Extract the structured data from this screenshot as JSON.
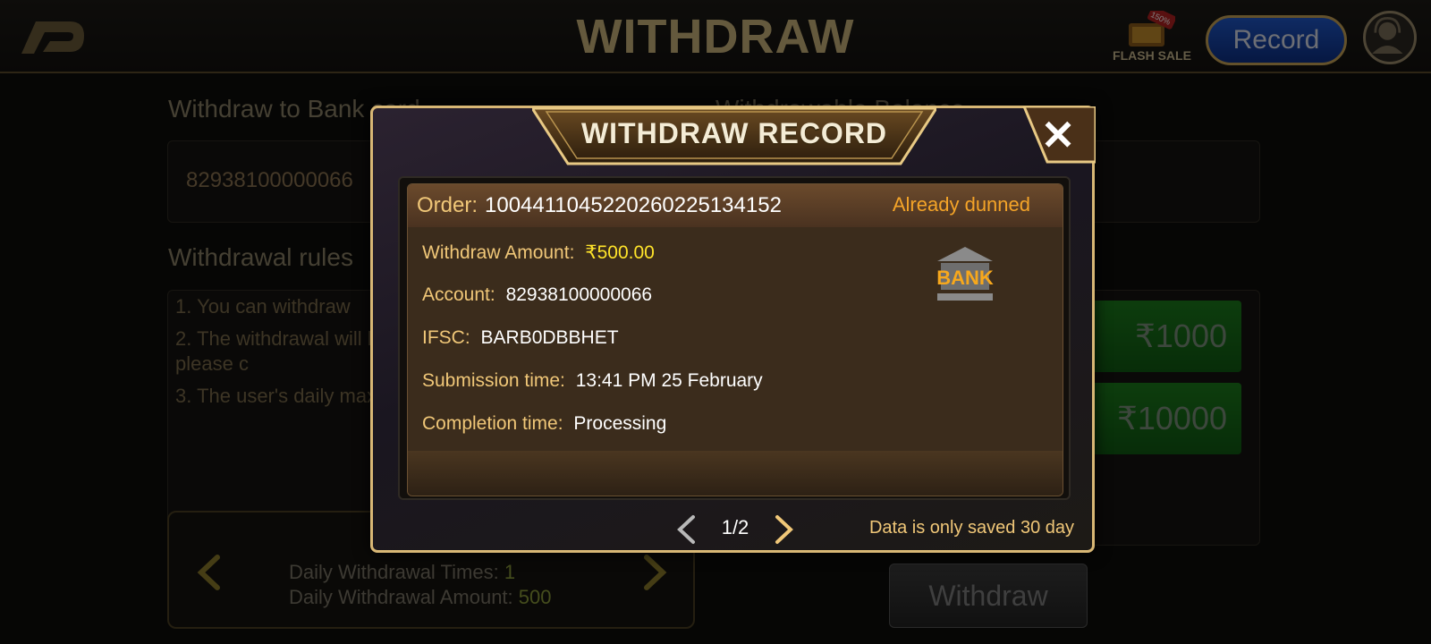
{
  "header": {
    "title": "WITHDRAW",
    "flash_sale_label": "FLASH SALE",
    "flash_sale_badge": "150%",
    "record_label": "Record"
  },
  "form": {
    "bank_label": "Withdraw to Bank card",
    "balance_label": "Withdrawable Balance",
    "bank_account": "82938100000066",
    "rules_title": "Withdrawal rules",
    "rules": [
      "1. You can withdraw",
      "2. The withdrawal will be credited within 24 hours at the latest, if not, please c",
      "3. The user's daily maximum withdrawal amount is 30,000."
    ],
    "amount_options": [
      "₹1000",
      "₹10000"
    ],
    "daily_times_label": "Daily Withdrawal Times:",
    "daily_times_value": "1",
    "daily_amount_label": "Daily Withdrawal Amount:",
    "daily_amount_value": "500",
    "withdraw_button": "Withdraw"
  },
  "modal": {
    "title": "WITHDRAW RECORD",
    "record": {
      "order_label": "Order:",
      "order_number": "100441104522026022513415 2",
      "status": "Already dunned",
      "amount_label": "Withdraw Amount:",
      "amount_value": "₹500.00",
      "account_label": "Account:",
      "account_value": "82938100000066",
      "ifsc_label": "IFSC:",
      "ifsc_value": "BARB0DBBHET",
      "submission_label": "Submission time:",
      "submission_value": "13:41 PM 25 February",
      "completion_label": "Completion time:",
      "completion_value": "Processing",
      "bank_icon_text": "BANK"
    },
    "pager": "1/2",
    "retention_note": "Data is only saved 30 day"
  },
  "colors": {
    "gold": "#d8b775",
    "label_gold": "#f0c778",
    "status_orange": "#f4a428",
    "amount_yellow": "#ffe42a",
    "record_blue": "#1f56c6",
    "green_button": "#1b7a1b"
  }
}
